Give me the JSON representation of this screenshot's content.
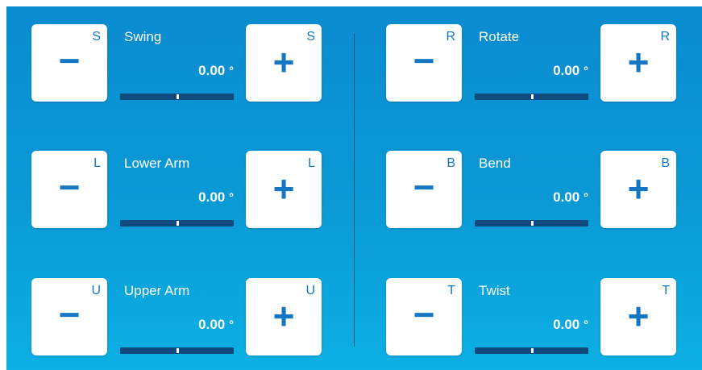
{
  "joints": [
    {
      "letter": "S",
      "label": "Swing",
      "value": "0.00",
      "unit": "°",
      "minus": "−",
      "plus": "+",
      "level": 0.5
    },
    {
      "letter": "L",
      "label": "Lower Arm",
      "value": "0.00",
      "unit": "°",
      "minus": "−",
      "plus": "+",
      "level": 0.5
    },
    {
      "letter": "U",
      "label": "Upper Arm",
      "value": "0.00",
      "unit": "°",
      "minus": "−",
      "plus": "+",
      "level": 0.5
    },
    {
      "letter": "R",
      "label": "Rotate",
      "value": "0.00",
      "unit": "°",
      "minus": "−",
      "plus": "+",
      "level": 0.5
    },
    {
      "letter": "B",
      "label": "Bend",
      "value": "0.00",
      "unit": "°",
      "minus": "−",
      "plus": "+",
      "level": 0.5
    },
    {
      "letter": "T",
      "label": "Twist",
      "value": "0.00",
      "unit": "°",
      "minus": "−",
      "plus": "+",
      "level": 0.5
    }
  ],
  "colors": {
    "accent": "#1577c4",
    "background": "#0a9ad6",
    "track": "#0e4a7e"
  },
  "icons": {
    "decrease": "minus-icon",
    "increase": "plus-icon"
  }
}
